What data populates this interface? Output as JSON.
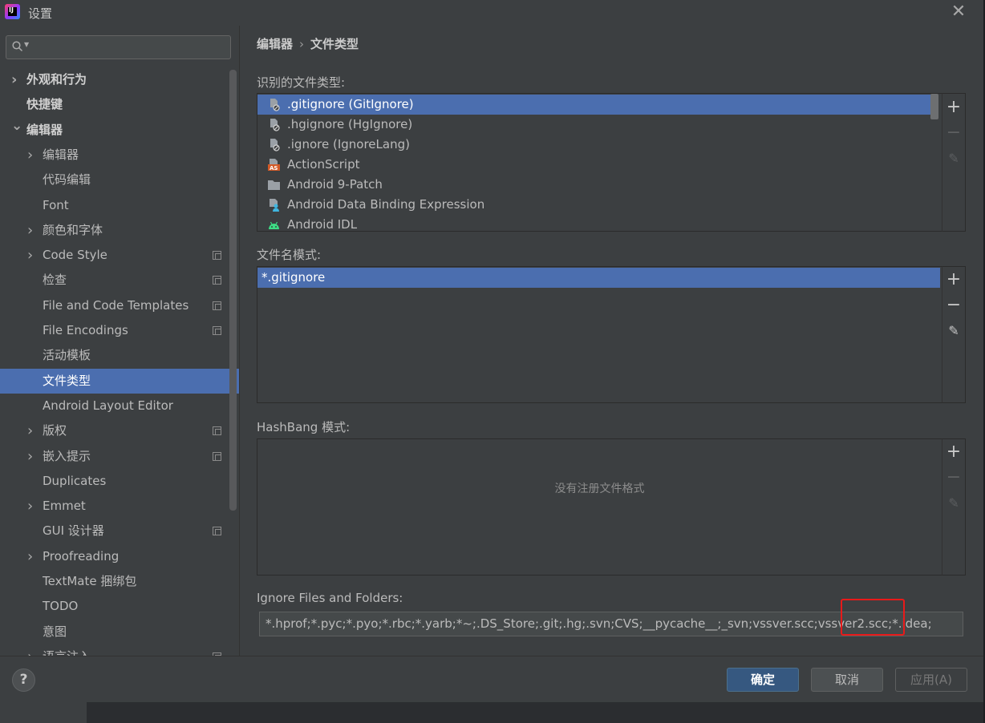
{
  "window": {
    "title": "设置"
  },
  "search": {
    "placeholder": ""
  },
  "sidebar": {
    "items": [
      {
        "label": "外观和行为",
        "expander": "collapsed",
        "level": 0,
        "bold": true
      },
      {
        "label": "快捷键",
        "expander": "none",
        "level": 0,
        "bold": true
      },
      {
        "label": "编辑器",
        "expander": "expanded",
        "level": 0,
        "bold": true
      },
      {
        "label": "编辑器",
        "expander": "collapsed",
        "level": 1
      },
      {
        "label": "代码编辑",
        "expander": "none",
        "level": 1
      },
      {
        "label": "Font",
        "expander": "none",
        "level": 1
      },
      {
        "label": "颜色和字体",
        "expander": "collapsed",
        "level": 1
      },
      {
        "label": "Code Style",
        "expander": "collapsed",
        "level": 1,
        "project": true
      },
      {
        "label": "检查",
        "expander": "none",
        "level": 1,
        "project": true
      },
      {
        "label": "File and Code Templates",
        "expander": "none",
        "level": 1,
        "project": true
      },
      {
        "label": "File Encodings",
        "expander": "none",
        "level": 1,
        "project": true
      },
      {
        "label": "活动模板",
        "expander": "none",
        "level": 1
      },
      {
        "label": "文件类型",
        "expander": "none",
        "level": 1,
        "selected": true
      },
      {
        "label": "Android Layout Editor",
        "expander": "none",
        "level": 1
      },
      {
        "label": "版权",
        "expander": "collapsed",
        "level": 1,
        "project": true
      },
      {
        "label": "嵌入提示",
        "expander": "collapsed",
        "level": 1,
        "project": true
      },
      {
        "label": "Duplicates",
        "expander": "none",
        "level": 1
      },
      {
        "label": "Emmet",
        "expander": "collapsed",
        "level": 1
      },
      {
        "label": "GUI 设计器",
        "expander": "none",
        "level": 1,
        "project": true
      },
      {
        "label": "Proofreading",
        "expander": "collapsed",
        "level": 1
      },
      {
        "label": "TextMate 捆绑包",
        "expander": "none",
        "level": 1
      },
      {
        "label": "TODO",
        "expander": "none",
        "level": 1
      },
      {
        "label": "意图",
        "expander": "none",
        "level": 1
      },
      {
        "label": "语言注入",
        "expander": "collapsed",
        "level": 1,
        "project": true
      }
    ]
  },
  "breadcrumb": {
    "parent": "编辑器",
    "current": "文件类型"
  },
  "recognized": {
    "label": "识别的文件类型:",
    "items": [
      {
        "label": ".gitignore (GitIgnore)",
        "icon": "ignore-file-icon",
        "selected": true
      },
      {
        "label": ".hgignore (HgIgnore)",
        "icon": "ignore-file-icon"
      },
      {
        "label": ".ignore (IgnoreLang)",
        "icon": "ignore-file-icon"
      },
      {
        "label": "ActionScript",
        "icon": "actionscript-icon"
      },
      {
        "label": "Android 9-Patch",
        "icon": "folder-icon"
      },
      {
        "label": "Android Data Binding Expression",
        "icon": "data-binding-icon"
      },
      {
        "label": "Android IDL",
        "icon": "android-icon"
      }
    ]
  },
  "patterns": {
    "label": "文件名模式:",
    "items": [
      {
        "label": "*.gitignore",
        "selected": true
      }
    ]
  },
  "hashbang": {
    "label": "HashBang 模式:",
    "empty_text": "没有注册文件格式"
  },
  "ignore": {
    "label": "Ignore Files and Folders:",
    "value": "*.hprof;*.pyc;*.pyo;*.rbc;*.yarb;*~;.DS_Store;.git;.hg;.svn;CVS;__pycache__;_svn;vssver.scc;vssver2.scc;*.idea;"
  },
  "footer": {
    "help": "?",
    "ok": "确定",
    "cancel": "取消",
    "apply": "应用(A)"
  },
  "colors": {
    "selection": "#4b6eaf",
    "background": "#3c3f41",
    "highlight_box": "#e81a1a"
  }
}
